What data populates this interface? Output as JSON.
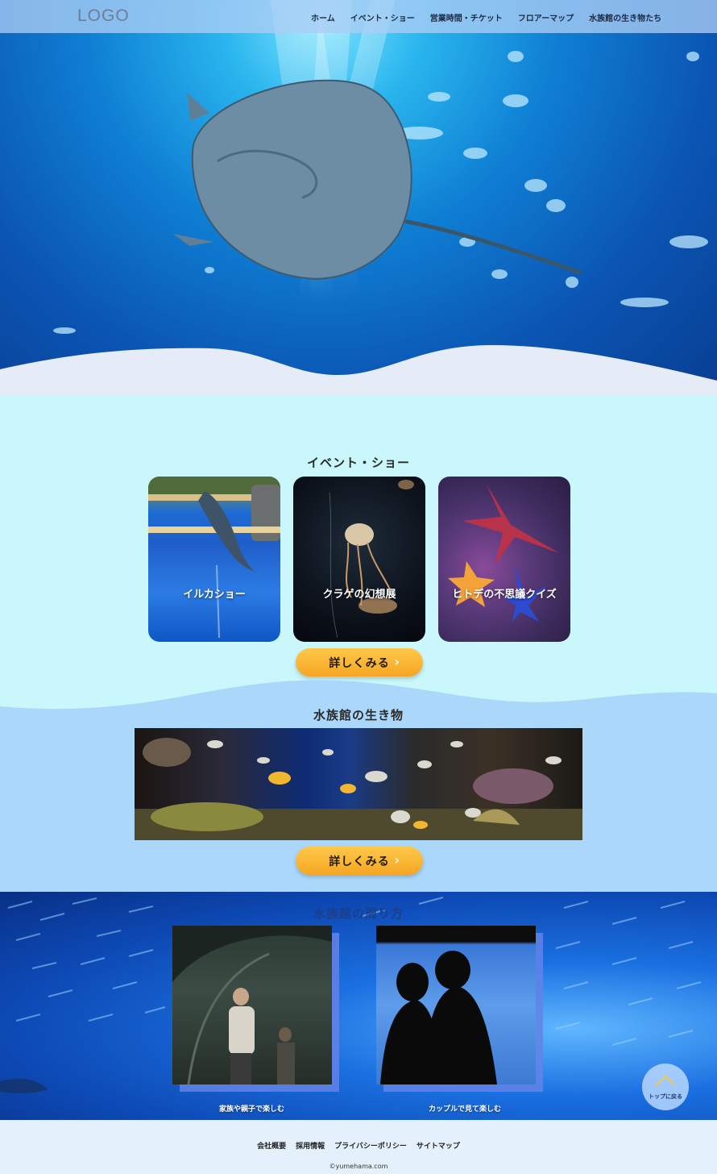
{
  "header": {
    "logo": "LOGO",
    "nav": [
      "ホーム",
      "イベント・ショー",
      "営業時間・チケット",
      "フロアーマップ",
      "水族館の生き物たち"
    ]
  },
  "events": {
    "title": "イベント・ショー",
    "cards": [
      {
        "label": "イルカショー"
      },
      {
        "label": "クラゲの幻想展"
      },
      {
        "label": "ヒトデの不思議クイズ"
      }
    ],
    "more_label": "詳しくみる"
  },
  "creatures": {
    "title": "水族館の生き物",
    "more_label": "詳しくみる"
  },
  "howto": {
    "title": "水族館の周り方",
    "photos": [
      {
        "caption": "家族や親子で楽しむ"
      },
      {
        "caption": "カップルで見て楽しむ"
      }
    ]
  },
  "to_top": {
    "label": "トップに戻る"
  },
  "footer": {
    "links": [
      "会社概要",
      "採用情報",
      "プライバシーポリシー",
      "サイトマップ"
    ],
    "copyright": "©yumehama.com"
  },
  "colors": {
    "page_bg": "#c9f7fb",
    "creature_bg": "#aad7fa",
    "button": "#f5a623",
    "footer_bg": "#e4f1fc"
  }
}
